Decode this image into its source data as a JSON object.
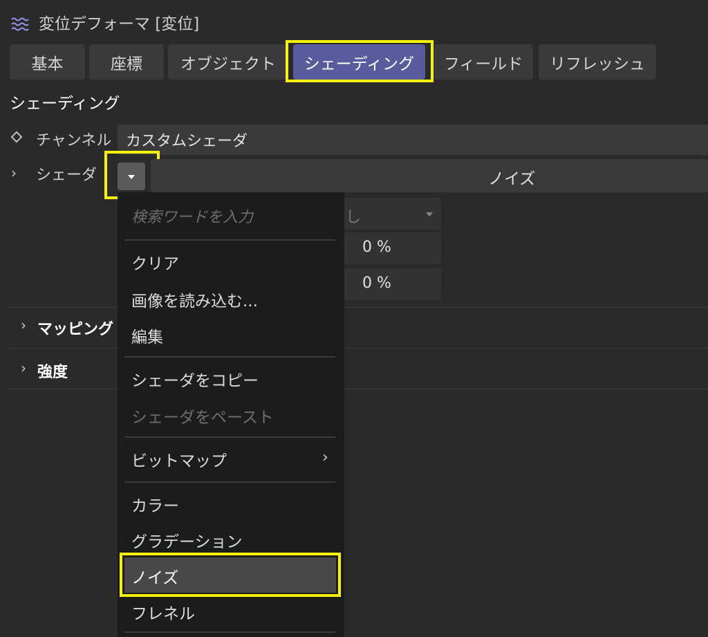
{
  "window": {
    "title": "変位デフォーマ [変位]",
    "icon": "deformer-waves-icon"
  },
  "tabs": [
    {
      "label": "基本"
    },
    {
      "label": "座標"
    },
    {
      "label": "オブジェクト"
    },
    {
      "label": "シェーディング",
      "active": true
    },
    {
      "label": "フィールド"
    },
    {
      "label": "リフレッシュ"
    }
  ],
  "section": {
    "heading": "シェーディング"
  },
  "channel": {
    "label": "チャンネル",
    "value": "カスタムシェーダ"
  },
  "shader": {
    "label": "シェーダ",
    "value": "ノイズ"
  },
  "hidden_fields": [
    {
      "value": "0 %"
    },
    {
      "value": "0 %"
    }
  ],
  "groups": [
    {
      "label": "マッピング"
    },
    {
      "label": "強度"
    }
  ],
  "menu": {
    "search_placeholder": "検索ワードを入力",
    "items": [
      {
        "label": "クリア"
      },
      {
        "label": "画像を読み込む..."
      },
      {
        "label": "編集"
      },
      {
        "label": "シェーダをコピー"
      },
      {
        "label": "シェーダをペースト",
        "disabled": true
      },
      {
        "label": "ビットマップ",
        "submenu": true
      },
      {
        "label": "カラー"
      },
      {
        "label": "グラデーション"
      },
      {
        "label": "ノイズ",
        "highlighted": true
      },
      {
        "label": "フレネル"
      }
    ]
  },
  "colors": {
    "accent_tab": "#595c9c",
    "highlight_box": "#f7f20a",
    "background": "#2a2a2a"
  }
}
